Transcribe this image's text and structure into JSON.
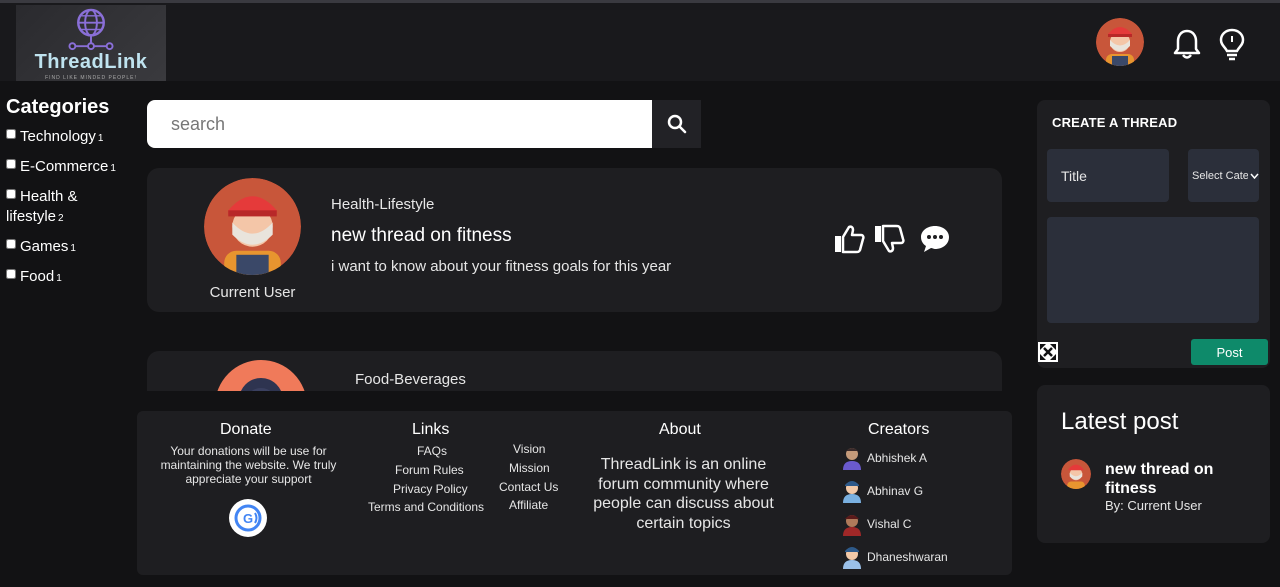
{
  "header": {
    "logo_title": "ThreadLink",
    "logo_tagline": "FIND LIKE MINDED PEOPLE!",
    "avatar_icon": "user-avatar-icon",
    "notifications_icon": "bell-icon",
    "ideas_icon": "lightbulb-icon"
  },
  "categories": {
    "heading": "Categories",
    "items": [
      {
        "label": "Technology",
        "count": "1"
      },
      {
        "label": "E-Commerce",
        "count": "1"
      },
      {
        "label": "Health & lifestyle",
        "count": "2"
      },
      {
        "label": "Games",
        "count": "1"
      },
      {
        "label": "Food",
        "count": "1"
      }
    ]
  },
  "search": {
    "placeholder": "search",
    "button_icon": "search-icon"
  },
  "threads": [
    {
      "category": "Health-Lifestyle",
      "title": "new thread on fitness",
      "body": "i want to know about your fitness goals for this year",
      "user": "Current User",
      "actions": [
        "thumbs-up-icon",
        "thumbs-down-icon",
        "comment-icon"
      ]
    },
    {
      "category": "Food-Beverages"
    }
  ],
  "create_thread": {
    "heading": "CREATE A THREAD",
    "title_placeholder": "Title",
    "category_select": "Select Category",
    "expand_icon": "expand-icon",
    "post_label": "Post"
  },
  "latest_post": {
    "heading": "Latest post",
    "title": "new thread on fitness",
    "by": "By: Current User"
  },
  "footer": {
    "donate": {
      "heading": "Donate",
      "text": "Your donations will be use for maintaining the website. We truly appreciate your support",
      "pay_icon": "gpay-icon"
    },
    "links": {
      "heading": "Links",
      "col1": [
        "FAQs",
        "Forum Rules",
        "Privacy Policy",
        "Terms and Conditions"
      ],
      "col2": [
        "Vision",
        "Mission",
        "Contact Us",
        "Affiliate"
      ]
    },
    "about": {
      "heading": "About",
      "text": "ThreadLink is an online forum community where people can discuss about certain topics"
    },
    "creators": {
      "heading": "Creators",
      "names": [
        "Abhishek A",
        "Abhinav G",
        "Vishal C",
        "Dhaneshwaran"
      ]
    }
  },
  "colors": {
    "background": "#121214",
    "card": "#1e1e21",
    "post_button": "#0e8a6a",
    "search_bg": "#ffffff"
  }
}
